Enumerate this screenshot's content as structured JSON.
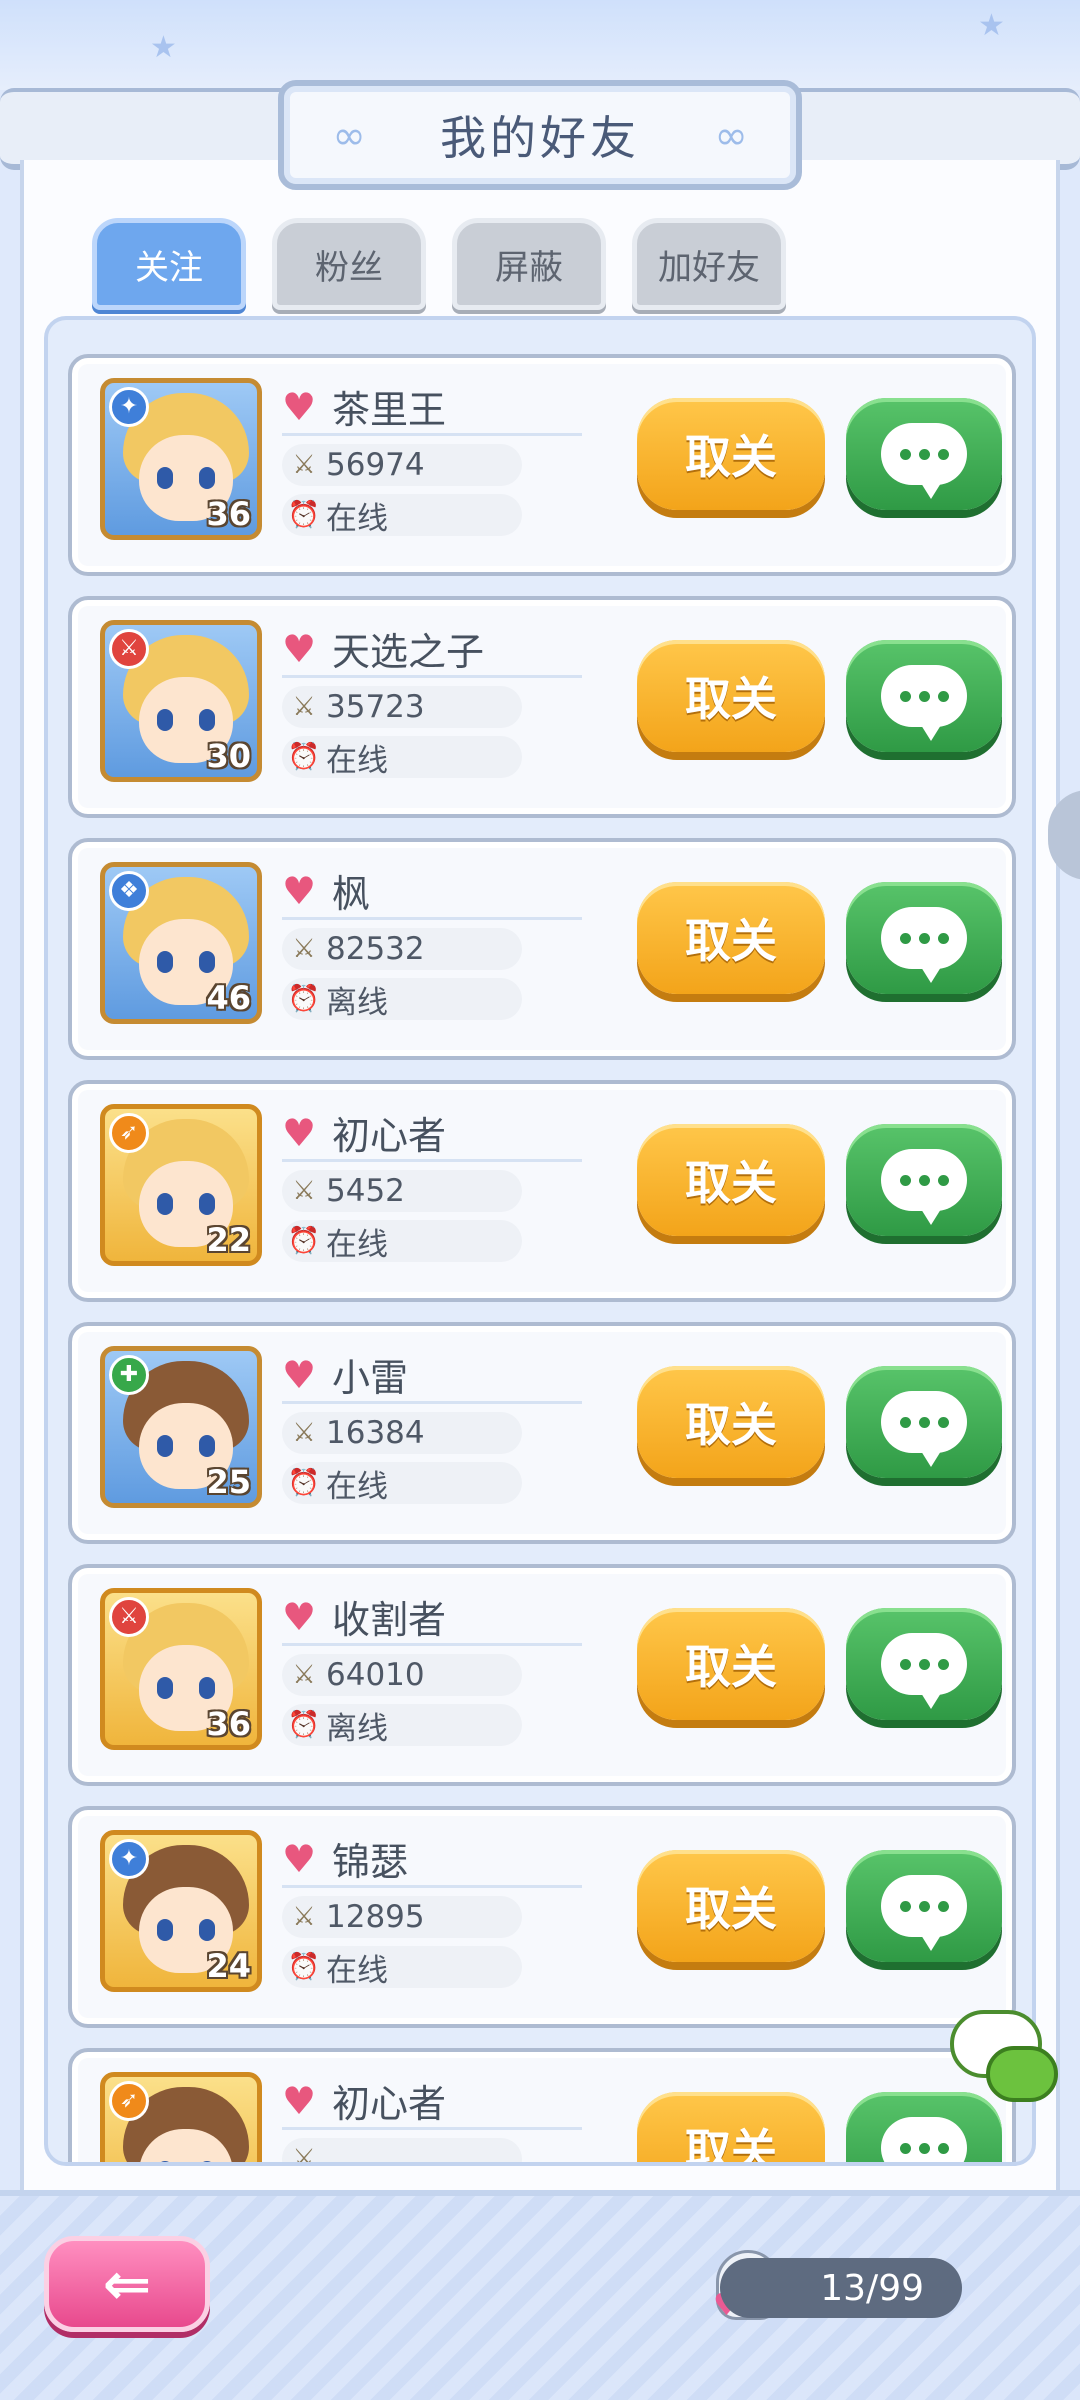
{
  "title": "我的好友",
  "tabs": [
    {
      "label": "关注",
      "active": true
    },
    {
      "label": "粉丝",
      "active": false
    },
    {
      "label": "屏蔽",
      "active": false
    },
    {
      "label": "加好友",
      "active": false
    }
  ],
  "buttons": {
    "unfollow_label": "取关"
  },
  "friends": [
    {
      "name": "茶里王",
      "power": "56974",
      "status": "在线",
      "level": "36",
      "class_icon": "mage-icon",
      "frame": "blue",
      "hair_color": "#f2c862"
    },
    {
      "name": "天选之子",
      "power": "35723",
      "status": "在线",
      "level": "30",
      "class_icon": "sword-icon",
      "frame": "blue",
      "hair_color": "#f2c862"
    },
    {
      "name": "枫",
      "power": "82532",
      "status": "离线",
      "level": "46",
      "class_icon": "book-icon",
      "frame": "blue",
      "hair_color": "#f2c862"
    },
    {
      "name": "初心者",
      "power": "5452",
      "status": "在线",
      "level": "22",
      "class_icon": "bow-icon",
      "frame": "gold",
      "hair_color": "#f2c862"
    },
    {
      "name": "小雷",
      "power": "16384",
      "status": "在线",
      "level": "25",
      "class_icon": "heal-icon",
      "frame": "blue",
      "hair_color": "#8a5a36"
    },
    {
      "name": "收割者",
      "power": "64010",
      "status": "离线",
      "level": "36",
      "class_icon": "sword-icon",
      "frame": "gold",
      "hair_color": "#f2c862"
    },
    {
      "name": "锦瑟",
      "power": "12895",
      "status": "在线",
      "level": "24",
      "class_icon": "mage-icon",
      "frame": "gold",
      "hair_color": "#8a5a36"
    },
    {
      "name": "初心者",
      "power": "",
      "status": "",
      "level": "",
      "class_icon": "bow-icon",
      "frame": "gold",
      "hair_color": "#8a5a36"
    }
  ],
  "footer": {
    "friend_count": "13/99"
  },
  "colors": {
    "tab_active": "#6ea7ee",
    "unfollow_button": "#f3a41a",
    "chat_button": "#2f9a45",
    "back_button": "#e8498d"
  }
}
